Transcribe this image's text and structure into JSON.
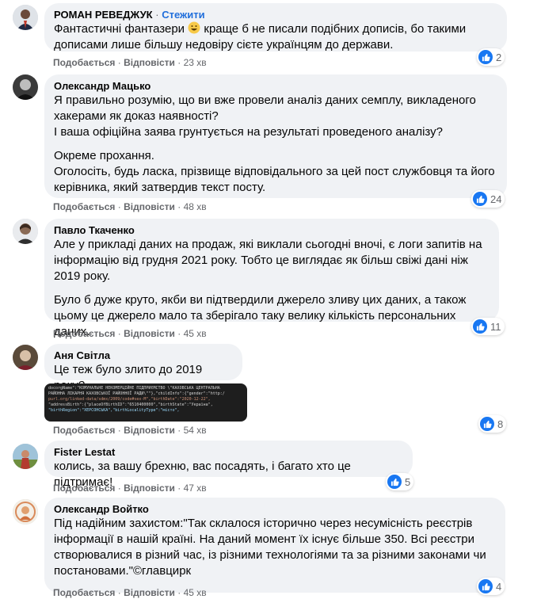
{
  "comments": [
    {
      "author": "РОМАН РЕВЕДЖУК",
      "follow_label": "Стежити",
      "lines": [
        [
          "Фантастичні фантазери ",
          " краще б не писали подібних дописів, бо такими"
        ],
        [
          "дописами лише більшу недовіру сієте українцям до держави."
        ]
      ],
      "like": "Подобається",
      "reply": "Відповісти",
      "time": "23 хв",
      "reactions": "2"
    },
    {
      "author": "Олександр Мацько",
      "paragraphs": [
        "Я правильно розумію, що ви вже провели аналіз даних семплу, викладеного хакерами як доказ наявності?\nІ ваша офіційна заява грунтується на результаті проведеного аналізу?",
        "Окреме прохання.\nОголосіть, будь ласка, прізвище відповідального за цей пост службовця та його керівника, який затвердив текст посту."
      ],
      "like": "Подобається",
      "reply": "Відповісти",
      "time": "48 хв",
      "reactions": "24"
    },
    {
      "author": "Павло Ткаченко",
      "paragraphs": [
        "Але у прикладі даних на продаж, які виклали сьогодні вночі, є логи запитів на інформацію від грудня 2021 року. Тобто це виглядає як більш свіжі дані ніж 2019 року.",
        "Було б дуже круто, якби ви підтвердили джерело зливу цих даних, а також цьому це джерело мало та зберігало таку велику кількість персональних даних."
      ],
      "like": "Подобається",
      "reply": "Відповісти",
      "time": "45 хв",
      "reactions": "11"
    },
    {
      "author": "Аня Світла",
      "paragraphs": [
        "Це теж було злито до 2019 року?"
      ],
      "code_lines": [
        "docorgName\":\"КОМУНАЛЬНЕ НЕКОМЕРЦІЙНЕ ПІДПРИЄМСТВО \\\"КАХОВСЬКА ЦЕНТРАЛЬНА",
        "РАЙОННА ЛІКАРНЯ КАХОВСЬКОЇ РАЙОННОЇ РАДИ\\\"\"},\"childInfo\":{\"gender\":\"http:/",
        "purl.org/linked-data/sdmx/2009/code#sex-M\",\"birthDate\":\"2020-12-22\",",
        "\"addressBirth\":{\"placeOfBirthID\":\"6510400000\",\"birthState\":\"Україна\",",
        "\"birthRegion\":\"ХЕРСОНСЬКА\",\"birthLocalityType\":\"місто\","
      ],
      "like": "Подобається",
      "reply": "Відповісти",
      "time": "54 хв",
      "reactions": "8"
    },
    {
      "author": "Fister Lestat",
      "paragraphs": [
        "колись, за вашу брехню, вас посадять, і багато хто це підтримає!"
      ],
      "like": "Подобається",
      "reply": "Відповісти",
      "time": "47 хв",
      "reactions": "5"
    },
    {
      "author": "Олександр Войтко",
      "paragraphs": [
        "Під надійним захистом:\"Так склалося історично через несумісність реєстрів інформації в нашій країні. На даний момент їх існує більше 350. Всі реєстри створювалися в різний час, із різними технологіями та за різними законами чи постановами.\"©главцирк"
      ],
      "like": "Подобається",
      "reply": "Відповісти",
      "time": "45 хв",
      "reactions": "4"
    }
  ],
  "separator": "·",
  "colors": {
    "link": "#216fdb",
    "bubble": "#f0f2f5",
    "like": "#1877f2",
    "meta": "#65676b"
  }
}
